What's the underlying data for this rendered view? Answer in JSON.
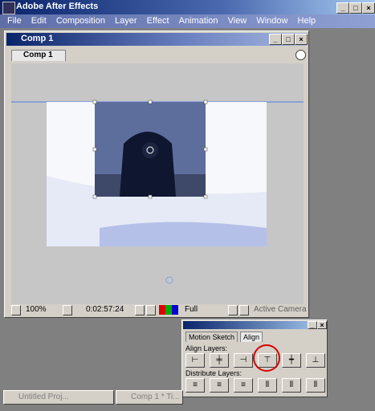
{
  "app": {
    "title": "Adobe After Effects"
  },
  "menu": [
    "File",
    "Edit",
    "Composition",
    "Layer",
    "Effect",
    "Animation",
    "View",
    "Window",
    "Help"
  ],
  "comp_window": {
    "title": "Comp 1",
    "tab": "Comp 1"
  },
  "viewer_controls": {
    "zoom": "100%",
    "timecode": "0:02:57:24",
    "resolution": "Full",
    "camera": "Active Camera"
  },
  "align_panel": {
    "tabs": [
      "Motion Sketch",
      "Align"
    ],
    "align_label": "Align Layers:",
    "distribute_label": "Distribute Layers:"
  },
  "taskbar": {
    "item1": "Untitled Proj...",
    "item2": "Comp 1 * Ti..."
  },
  "colors": {
    "highlight_circle": "#d80000"
  }
}
